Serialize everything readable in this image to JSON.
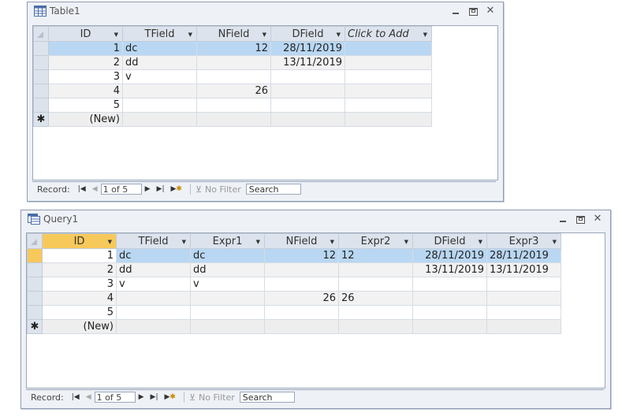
{
  "table1": {
    "title": "Table1",
    "columns": [
      {
        "label": "ID"
      },
      {
        "label": "TField"
      },
      {
        "label": "NField"
      },
      {
        "label": "DField"
      },
      {
        "label": "Click to Add"
      }
    ],
    "rows": [
      {
        "id": "1",
        "tfield": "dc",
        "nfield": "12",
        "dfield": "28/11/2019"
      },
      {
        "id": "2",
        "tfield": "dd",
        "nfield": "",
        "dfield": "13/11/2019"
      },
      {
        "id": "3",
        "tfield": "v",
        "nfield": "",
        "dfield": ""
      },
      {
        "id": "4",
        "tfield": "",
        "nfield": "26",
        "dfield": ""
      },
      {
        "id": "5",
        "tfield": "",
        "nfield": "",
        "dfield": ""
      }
    ],
    "new_row": "(New)",
    "new_marker": "✱",
    "nav": {
      "label": "Record:",
      "current": "1 of 5",
      "filter": "No Filter",
      "search": "Search"
    }
  },
  "query1": {
    "title": "Query1",
    "columns": [
      {
        "label": "ID"
      },
      {
        "label": "TField"
      },
      {
        "label": "Expr1"
      },
      {
        "label": "NField"
      },
      {
        "label": "Expr2"
      },
      {
        "label": "DField"
      },
      {
        "label": "Expr3"
      }
    ],
    "rows": [
      {
        "id": "1",
        "tfield": "dc",
        "expr1": "dc",
        "nfield": "12",
        "expr2": "12",
        "dfield": "28/11/2019",
        "expr3": "28/11/2019"
      },
      {
        "id": "2",
        "tfield": "dd",
        "expr1": "dd",
        "nfield": "",
        "expr2": "",
        "dfield": "13/11/2019",
        "expr3": "13/11/2019"
      },
      {
        "id": "3",
        "tfield": "v",
        "expr1": "v",
        "nfield": "",
        "expr2": "",
        "dfield": "",
        "expr3": ""
      },
      {
        "id": "4",
        "tfield": "",
        "expr1": "",
        "nfield": "26",
        "expr2": "26",
        "dfield": "",
        "expr3": ""
      },
      {
        "id": "5",
        "tfield": "",
        "expr1": "",
        "nfield": "",
        "expr2": "",
        "dfield": "",
        "expr3": ""
      }
    ],
    "new_row": "(New)",
    "new_marker": "✱",
    "nav": {
      "label": "Record:",
      "current": "1 of 5",
      "filter": "No Filter",
      "search": "Search"
    }
  },
  "colors": {
    "selected_header": "#f7c85a",
    "current_row": "#b9d7f3",
    "window_bg": "#eef1f6"
  }
}
